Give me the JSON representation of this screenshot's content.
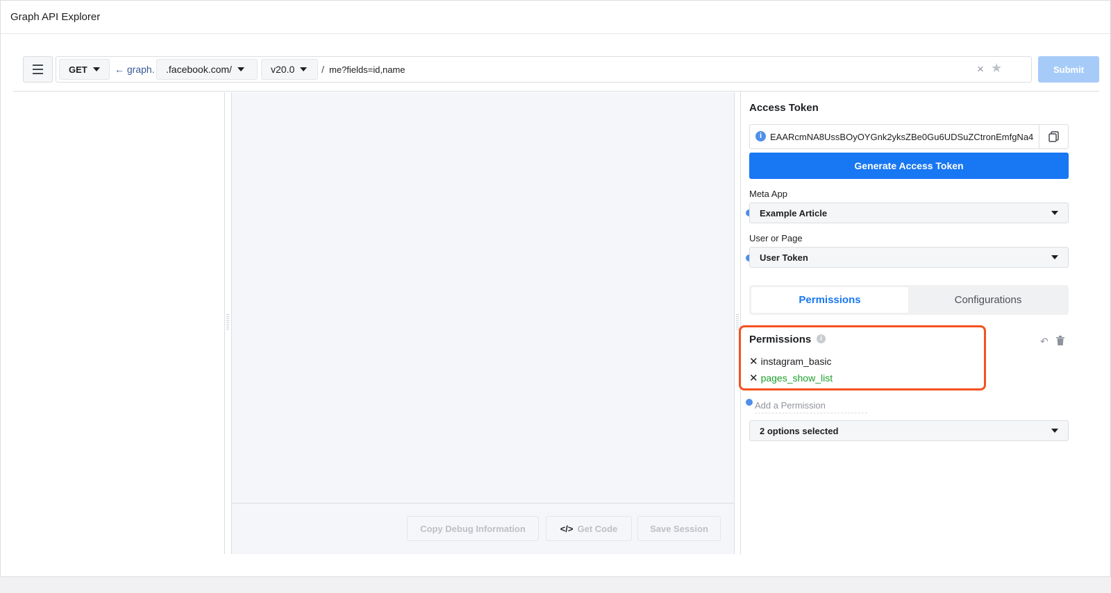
{
  "app": {
    "title": "Graph API Explorer"
  },
  "request": {
    "method": "GET",
    "graph_link": "← graph.",
    "domain": ".facebook.com/",
    "version": "v20.0",
    "slash": "/",
    "path": "me?fields=id,name",
    "clear": "×",
    "star": "★",
    "submit_label": "Submit"
  },
  "response_footer": {
    "copy_debug_label": "Copy Debug Information",
    "get_code_label": "Get Code",
    "get_code_icon": "</>",
    "save_session_label": "Save Session"
  },
  "access": {
    "heading": "Access Token",
    "info_icon": "i",
    "token": "EAARcmNA8UssBOyOYGnk2yksZBe0Gu6UDSuZCtronEmfgNa4",
    "generate_label": "Generate Access Token",
    "meta_app_label": "Meta App",
    "meta_app_value": "Example Article",
    "user_page_label": "User or Page",
    "user_page_value": "User Token"
  },
  "tabs": [
    {
      "label": "Permissions",
      "active": true
    },
    {
      "label": "Configurations",
      "active": false
    }
  ],
  "permissions": {
    "title": "Permissions",
    "info_icon": "i",
    "items": [
      {
        "label": "instagram_basic",
        "remove": "✕",
        "color": "#1c1e21"
      },
      {
        "label": "pages_show_list",
        "remove": "✕",
        "color": "#1e9e2b"
      }
    ],
    "add_placeholder": "Add a Permission",
    "selected_summary": "2 options selected",
    "highlight_color": "#f4511e"
  },
  "colors": {
    "primary": "#1877f2",
    "submit_disabled": "#a7cbf8",
    "dot": "#4e8fea"
  }
}
